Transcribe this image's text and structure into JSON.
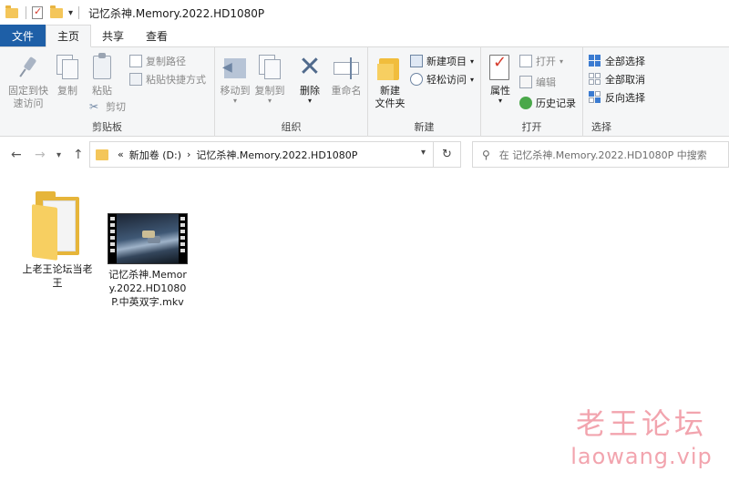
{
  "window": {
    "title": "记忆杀神.Memory.2022.HD1080P"
  },
  "tabs": [
    {
      "label": "文件"
    },
    {
      "label": "主页"
    },
    {
      "label": "共享"
    },
    {
      "label": "查看"
    }
  ],
  "ribbon": {
    "clipboard": {
      "pin": "固定到快\n速访问",
      "copy": "复制",
      "paste": "粘贴",
      "copy_path": "复制路径",
      "paste_shortcut": "粘贴快捷方式",
      "cut": "剪切",
      "label": "剪贴板"
    },
    "organize": {
      "move_to": "移动到",
      "copy_to": "复制到",
      "delete": "删除",
      "rename": "重命名",
      "label": "组织"
    },
    "new": {
      "new_folder": "新建\n文件夹",
      "new_item": "新建项目",
      "easy_access": "轻松访问",
      "label": "新建"
    },
    "open": {
      "properties": "属性",
      "open": "打开",
      "edit": "编辑",
      "history": "历史记录",
      "label": "打开"
    },
    "select": {
      "select_all": "全部选择",
      "select_none": "全部取消",
      "invert": "反向选择",
      "label": "选择"
    }
  },
  "address": {
    "prefix": "«",
    "drive": "新加卷 (D:)",
    "sep": "›",
    "folder": "记忆杀神.Memory.2022.HD1080P"
  },
  "search": {
    "placeholder": "在 记忆杀神.Memory.2022.HD1080P 中搜索"
  },
  "files": [
    {
      "name": "上老王论坛当老王",
      "type": "folder"
    },
    {
      "name": "记忆杀神.Memory.2022.HD1080P.中英双字.mkv",
      "type": "video"
    }
  ],
  "watermark": {
    "line1": "老王论坛",
    "line2": "laowang.vip"
  },
  "colors": {
    "file_tab": "#1e5fa7",
    "folder": "#f7cf61",
    "watermark": "#e85b6c"
  }
}
